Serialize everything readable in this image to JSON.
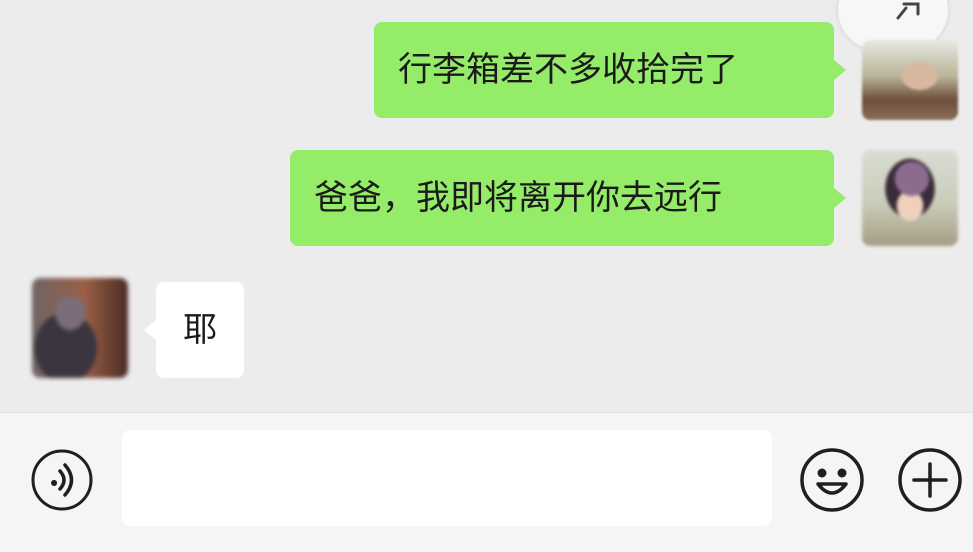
{
  "chat": {
    "messages": [
      {
        "sender": "me",
        "text": "行李箱差不多收拾完了"
      },
      {
        "sender": "me",
        "text": "爸爸，我即将离开你去远行"
      },
      {
        "sender": "other",
        "text": "耶"
      }
    ]
  },
  "input_bar": {
    "message_value": "",
    "voice_icon": "voice-icon",
    "emoji_icon": "emoji-icon",
    "plus_icon": "plus-icon"
  },
  "colors": {
    "chat_background": "#ececec",
    "my_bubble": "#95ec69",
    "other_bubble": "#ffffff",
    "input_bar": "#f5f5f5"
  }
}
